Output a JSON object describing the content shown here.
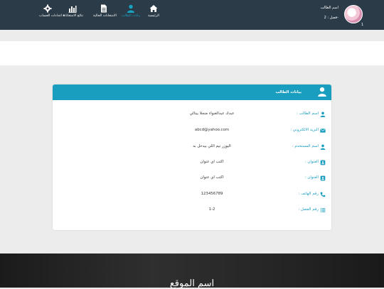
{
  "nav": {
    "items": [
      {
        "label": "الرئيسية",
        "icon": "home-icon"
      },
      {
        "label": "بيانات الطالب",
        "icon": "user-icon",
        "active": true
      },
      {
        "label": "الامتحانات الحالية",
        "icon": "document-icon"
      },
      {
        "label": "نتائج الامتحانات",
        "icon": "bar-chart-icon"
      },
      {
        "label": "اعدادات الحساب ▾",
        "icon": "gear-icon"
      }
    ]
  },
  "profile": {
    "name": "اسم الطالب",
    "class": "فصل : 2-",
    "page_number": "1"
  },
  "card": {
    "title": "بيانات الطالب",
    "fields": [
      {
        "label": "اسم الطالب :",
        "value": "عبدك عبدالغنواء منجلا بيتالي",
        "icon": "user-icon"
      },
      {
        "label": "البريد الالكتروني :",
        "value": "abcd@yahoo.com",
        "icon": "envelope-icon"
      },
      {
        "label": "اسم المستخدم :",
        "value": "اليوزر نيم اللي بيدخل به",
        "icon": "user-icon"
      },
      {
        "label": "العنوان :",
        "value": "اكتب اي عنوان",
        "icon": "address-card-icon"
      },
      {
        "label": "العنوان :",
        "value": "اكتب اي عنوان",
        "icon": "address-card-icon"
      },
      {
        "label": "رقم الهاتف :",
        "value": "123456789",
        "icon": "phone-icon"
      },
      {
        "label": "رقم الفصل :",
        "value": "1-2",
        "icon": "list-icon"
      }
    ]
  },
  "footer": {
    "site_name": "اسم الموقع"
  },
  "colors": {
    "accent": "#1a9ec0",
    "topbar": "#2b3b47",
    "footer": "#242424"
  }
}
